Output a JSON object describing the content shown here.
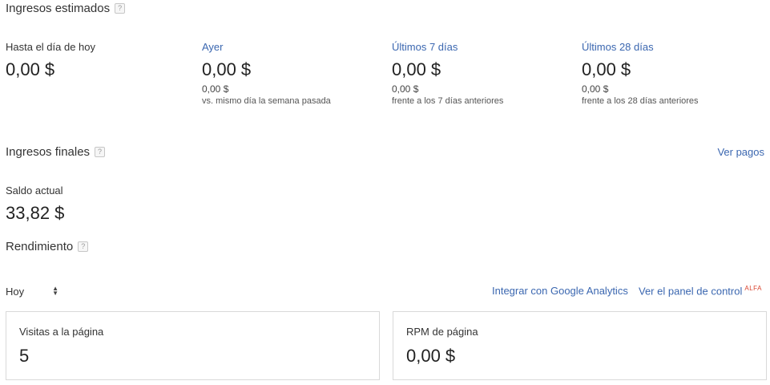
{
  "estimated": {
    "title": "Ingresos estimados",
    "help": "?",
    "columns": [
      {
        "label": "Hasta el día de hoy",
        "amount": "0,00 $",
        "sub_amount": "",
        "note": ""
      },
      {
        "label": "Ayer",
        "amount": "0,00 $",
        "sub_amount": "0,00 $",
        "note": "vs. mismo día la semana pasada"
      },
      {
        "label": "Últimos 7 días",
        "amount": "0,00 $",
        "sub_amount": "0,00 $",
        "note": "frente a los 7 días anteriores"
      },
      {
        "label": "Últimos 28 días",
        "amount": "0,00 $",
        "sub_amount": "0,00 $",
        "note": "frente a los 28 días anteriores"
      }
    ]
  },
  "final": {
    "title": "Ingresos finales",
    "help": "?",
    "payments_link": "Ver pagos",
    "balance_label": "Saldo actual",
    "balance_amount": "33,82 $"
  },
  "performance": {
    "title": "Rendimiento",
    "help": "?",
    "period_select": "Hoy",
    "analytics_link": "Integrar con Google Analytics",
    "dashboard_link": "Ver el panel de control",
    "alfa_badge": "ALFA",
    "cards": [
      {
        "label": "Visitas a la página",
        "value": "5"
      },
      {
        "label": "RPM de página",
        "value": "0,00 $"
      }
    ]
  }
}
